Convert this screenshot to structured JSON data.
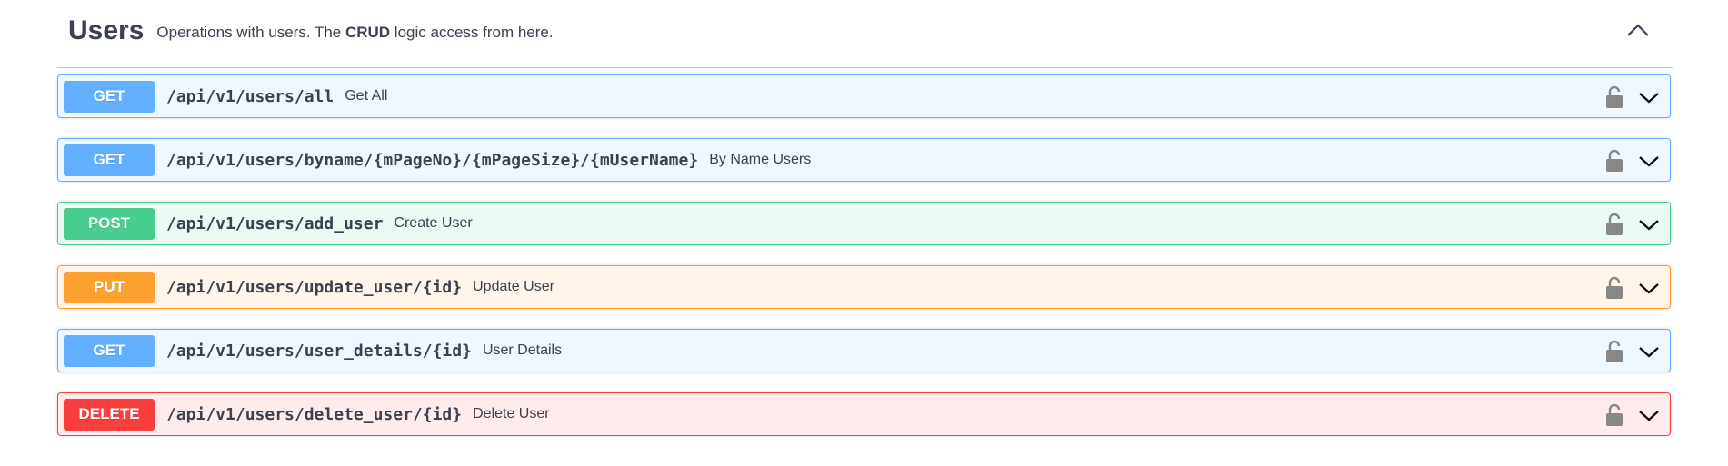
{
  "section": {
    "title": "Users",
    "desc_prefix": "Operations with users. The ",
    "desc_bold": "CRUD",
    "desc_suffix": " logic access from here.",
    "collapse_icon": "chevron-up-icon"
  },
  "operations": [
    {
      "method": "GET",
      "path": "/api/v1/users/all",
      "summary": "Get All"
    },
    {
      "method": "GET",
      "path": "/api/v1/users/byname/{mPageNo}/{mPageSize}/{mUserName}",
      "summary": "By Name Users"
    },
    {
      "method": "POST",
      "path": "/api/v1/users/add_user",
      "summary": "Create User"
    },
    {
      "method": "PUT",
      "path": "/api/v1/users/update_user/{id}",
      "summary": "Update User"
    },
    {
      "method": "GET",
      "path": "/api/v1/users/user_details/{id}",
      "summary": "User Details"
    },
    {
      "method": "DELETE",
      "path": "/api/v1/users/delete_user/{id}",
      "summary": "Delete User"
    }
  ],
  "icons": {
    "lock": "unlocked-padlock-icon",
    "expand": "chevron-down-icon"
  },
  "colors": {
    "get": "#61affe",
    "post": "#49cc90",
    "put": "#fca130",
    "delete": "#f93e3e",
    "text": "#3b4151"
  }
}
